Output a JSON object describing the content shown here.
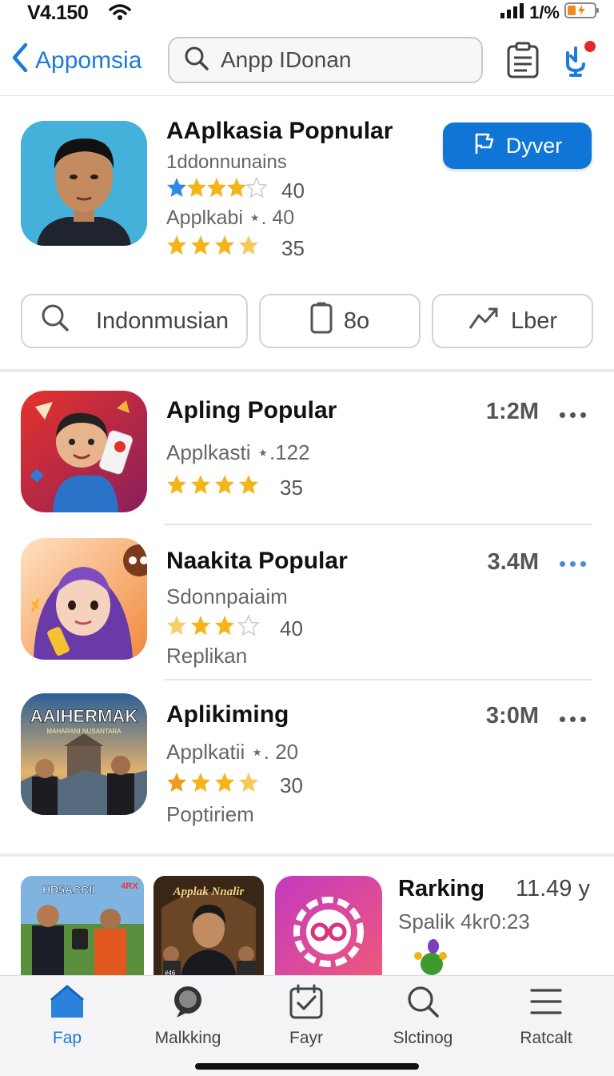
{
  "status": {
    "time": "V4.150",
    "battery": "1/%"
  },
  "nav": {
    "back_label": "Appomsia",
    "search_placeholder": "Anpp IDonan"
  },
  "featured": {
    "title": "AAplkasia Popnular",
    "subtitle": "1ddonnunains",
    "rating1": {
      "stars": 4,
      "value": "40"
    },
    "meta": "Applkabi ⋆. 40",
    "rating2": {
      "stars": 4,
      "value": "35"
    },
    "primary_button": "Dyver"
  },
  "chips": [
    {
      "label": "Indonmusian",
      "icon": "search-icon"
    },
    {
      "label": "8o",
      "icon": "phone-icon"
    },
    {
      "label": "Lber",
      "icon": "trend-icon"
    }
  ],
  "apps": [
    {
      "title": "Apling Popular",
      "line1": "Applkasti ⋆.122",
      "stars": 4,
      "rating": "35",
      "line3": "",
      "size": "1:2M",
      "more_color": "gray"
    },
    {
      "title": "Naakita Popular",
      "line1": "Sdonnpaiaim",
      "stars": 3,
      "rating": "40",
      "line3": "Replikan",
      "size": "3.4M",
      "more_color": "blue"
    },
    {
      "title": "Aplikiming",
      "line1": "Applkatii ⋆. 20",
      "stars": 4,
      "rating": "30",
      "line3": "Poptiriem",
      "size": "3:0M",
      "more_color": "gray"
    }
  ],
  "app_icon_texts": {
    "third": "AAIHERMAK",
    "third_sub": "MAHARANI NUSANTARA",
    "rank1_title": "HD5ACCII",
    "rank1_badge": "4RX",
    "rank2_title": "Applak Nnalir",
    "rank2_badge": "#46"
  },
  "ranking": {
    "title": "Rarking",
    "time": "11.49 y",
    "subtitle": "Spalik 4kr0:23"
  },
  "tabs": [
    {
      "label": "Fap",
      "icon": "home-icon",
      "active": true
    },
    {
      "label": "Malkking",
      "icon": "chat-icon",
      "active": false
    },
    {
      "label": "Fayr",
      "icon": "check-calendar-icon",
      "active": false
    },
    {
      "label": "Slctinog",
      "icon": "search-icon",
      "active": false
    },
    {
      "label": "Ratcalt",
      "icon": "menu-icon",
      "active": false
    }
  ],
  "colors": {
    "accent": "#0f75d6",
    "star": "#f4b41a",
    "star_blue": "#2f8ae6"
  }
}
